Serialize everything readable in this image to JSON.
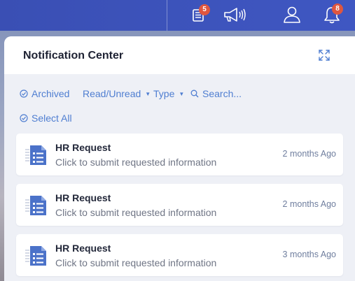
{
  "topbar": {
    "news_badge": "5",
    "bell_badge": "8",
    "icons": [
      "news-icon",
      "megaphone-icon",
      "user-icon",
      "bell-icon"
    ]
  },
  "panel": {
    "title": "Notification Center",
    "filters": {
      "archived": "Archived",
      "read_unread": "Read/Unread",
      "type": "Type",
      "search_placeholder": "Search...",
      "select_all": "Select All"
    },
    "notifications": [
      {
        "title": "HR Request",
        "subtitle": "Click to submit requested information",
        "time": "2 months Ago"
      },
      {
        "title": "HR Request",
        "subtitle": "Click to submit requested information",
        "time": "2 months Ago"
      },
      {
        "title": "HR Request",
        "subtitle": "Click to submit requested information",
        "time": "3 months Ago"
      }
    ]
  },
  "colors": {
    "topbar": "#3f57c2",
    "accent": "#4f7ed1",
    "badge": "#e0563f"
  }
}
